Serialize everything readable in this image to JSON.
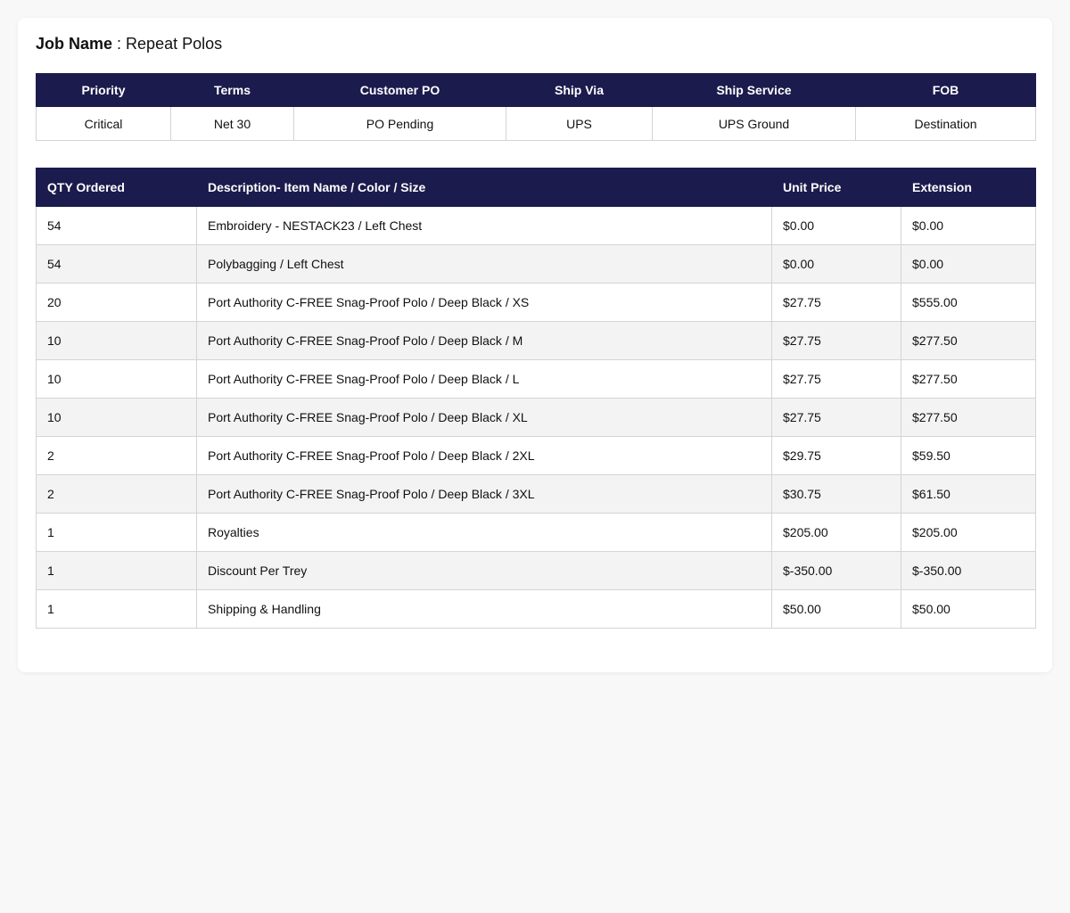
{
  "job": {
    "label": "Job Name",
    "separator": " : ",
    "value": "Repeat Polos"
  },
  "meta": {
    "headers": {
      "priority": "Priority",
      "terms": "Terms",
      "customer_po": "Customer PO",
      "ship_via": "Ship Via",
      "ship_service": "Ship Service",
      "fob": "FOB"
    },
    "values": {
      "priority": "Critical",
      "terms": "Net 30",
      "customer_po": "PO Pending",
      "ship_via": "UPS",
      "ship_service": "UPS Ground",
      "fob": "Destination"
    }
  },
  "items": {
    "headers": {
      "qty": "QTY Ordered",
      "description": "Description- Item Name / Color / Size",
      "unit_price": "Unit Price",
      "extension": "Extension"
    },
    "rows": [
      {
        "qty": "54",
        "description": "Embroidery - NESTACK23 / Left Chest",
        "unit_price": "$0.00",
        "extension": "$0.00"
      },
      {
        "qty": "54",
        "description": "Polybagging / Left Chest",
        "unit_price": "$0.00",
        "extension": "$0.00"
      },
      {
        "qty": "20",
        "description": "Port Authority C-FREE Snag-Proof Polo / Deep Black / XS",
        "unit_price": "$27.75",
        "extension": "$555.00"
      },
      {
        "qty": "10",
        "description": "Port Authority C-FREE Snag-Proof Polo / Deep Black / M",
        "unit_price": "$27.75",
        "extension": "$277.50"
      },
      {
        "qty": "10",
        "description": "Port Authority C-FREE Snag-Proof Polo / Deep Black / L",
        "unit_price": "$27.75",
        "extension": "$277.50"
      },
      {
        "qty": "10",
        "description": "Port Authority C-FREE Snag-Proof Polo / Deep Black / XL",
        "unit_price": "$27.75",
        "extension": "$277.50"
      },
      {
        "qty": "2",
        "description": "Port Authority C-FREE Snag-Proof Polo / Deep Black / 2XL",
        "unit_price": "$29.75",
        "extension": "$59.50"
      },
      {
        "qty": "2",
        "description": "Port Authority C-FREE Snag-Proof Polo / Deep Black / 3XL",
        "unit_price": "$30.75",
        "extension": "$61.50"
      },
      {
        "qty": "1",
        "description": "Royalties",
        "unit_price": "$205.00",
        "extension": "$205.00"
      },
      {
        "qty": "1",
        "description": "Discount Per Trey",
        "unit_price": "$-350.00",
        "extension": "$-350.00"
      },
      {
        "qty": "1",
        "description": "Shipping & Handling",
        "unit_price": "$50.00",
        "extension": "$50.00"
      }
    ]
  },
  "colors": {
    "header_bg": "#1c1b4d",
    "header_text": "#ffffff",
    "row_alt_bg": "#f3f3f3",
    "border": "#d4d4d4"
  }
}
